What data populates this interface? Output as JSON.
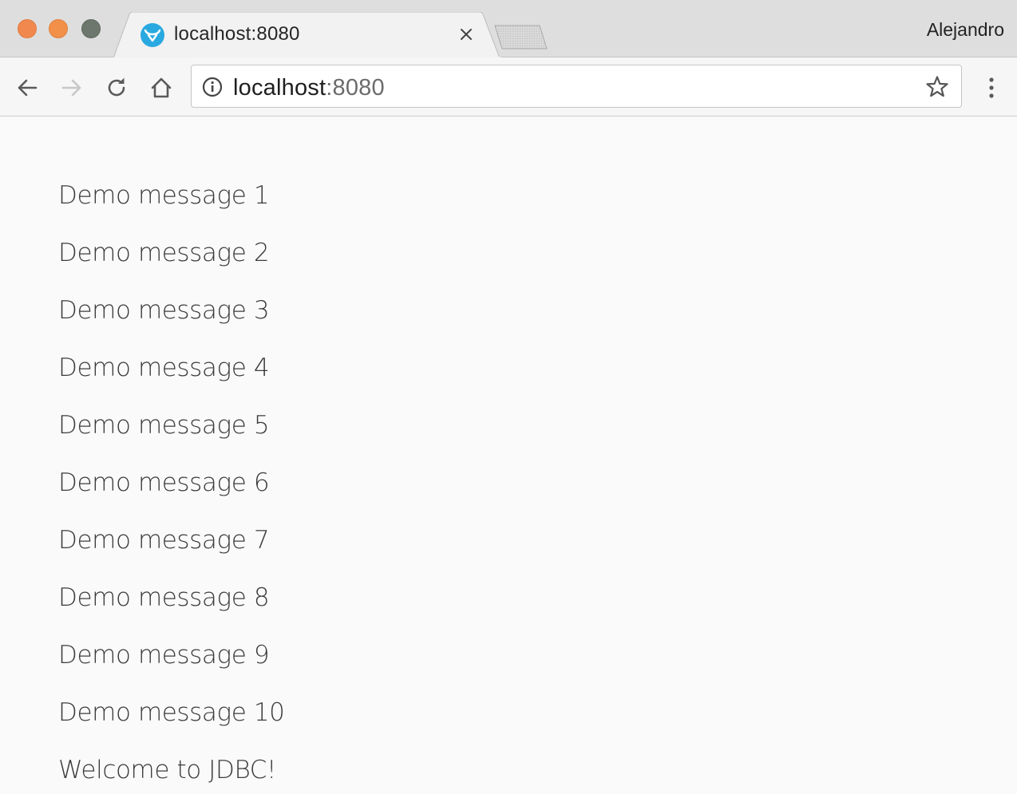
{
  "window": {
    "controls": [
      "close",
      "minimize",
      "maximize"
    ]
  },
  "tab": {
    "title": "localhost:8080",
    "favicon": "vaadin-favicon-icon",
    "favicon_color": "#29a9e0"
  },
  "profile": {
    "name": "Alejandro"
  },
  "toolbar": {
    "back_icon": "arrow-left-icon",
    "forward_icon": "arrow-right-icon",
    "reload_icon": "reload-icon",
    "home_icon": "home-icon",
    "menu_icon": "vertical-dots-icon"
  },
  "omnibox": {
    "host": "localhost",
    "port": ":8080",
    "info_icon": "info-icon",
    "bookmark_icon": "star-icon"
  },
  "page": {
    "messages": [
      "Demo message 1",
      "Demo message 2",
      "Demo message 3",
      "Demo message 4",
      "Demo message 5",
      "Demo message 6",
      "Demo message 7",
      "Demo message 8",
      "Demo message 9",
      "Demo message 10",
      "Welcome to JDBC!"
    ]
  }
}
